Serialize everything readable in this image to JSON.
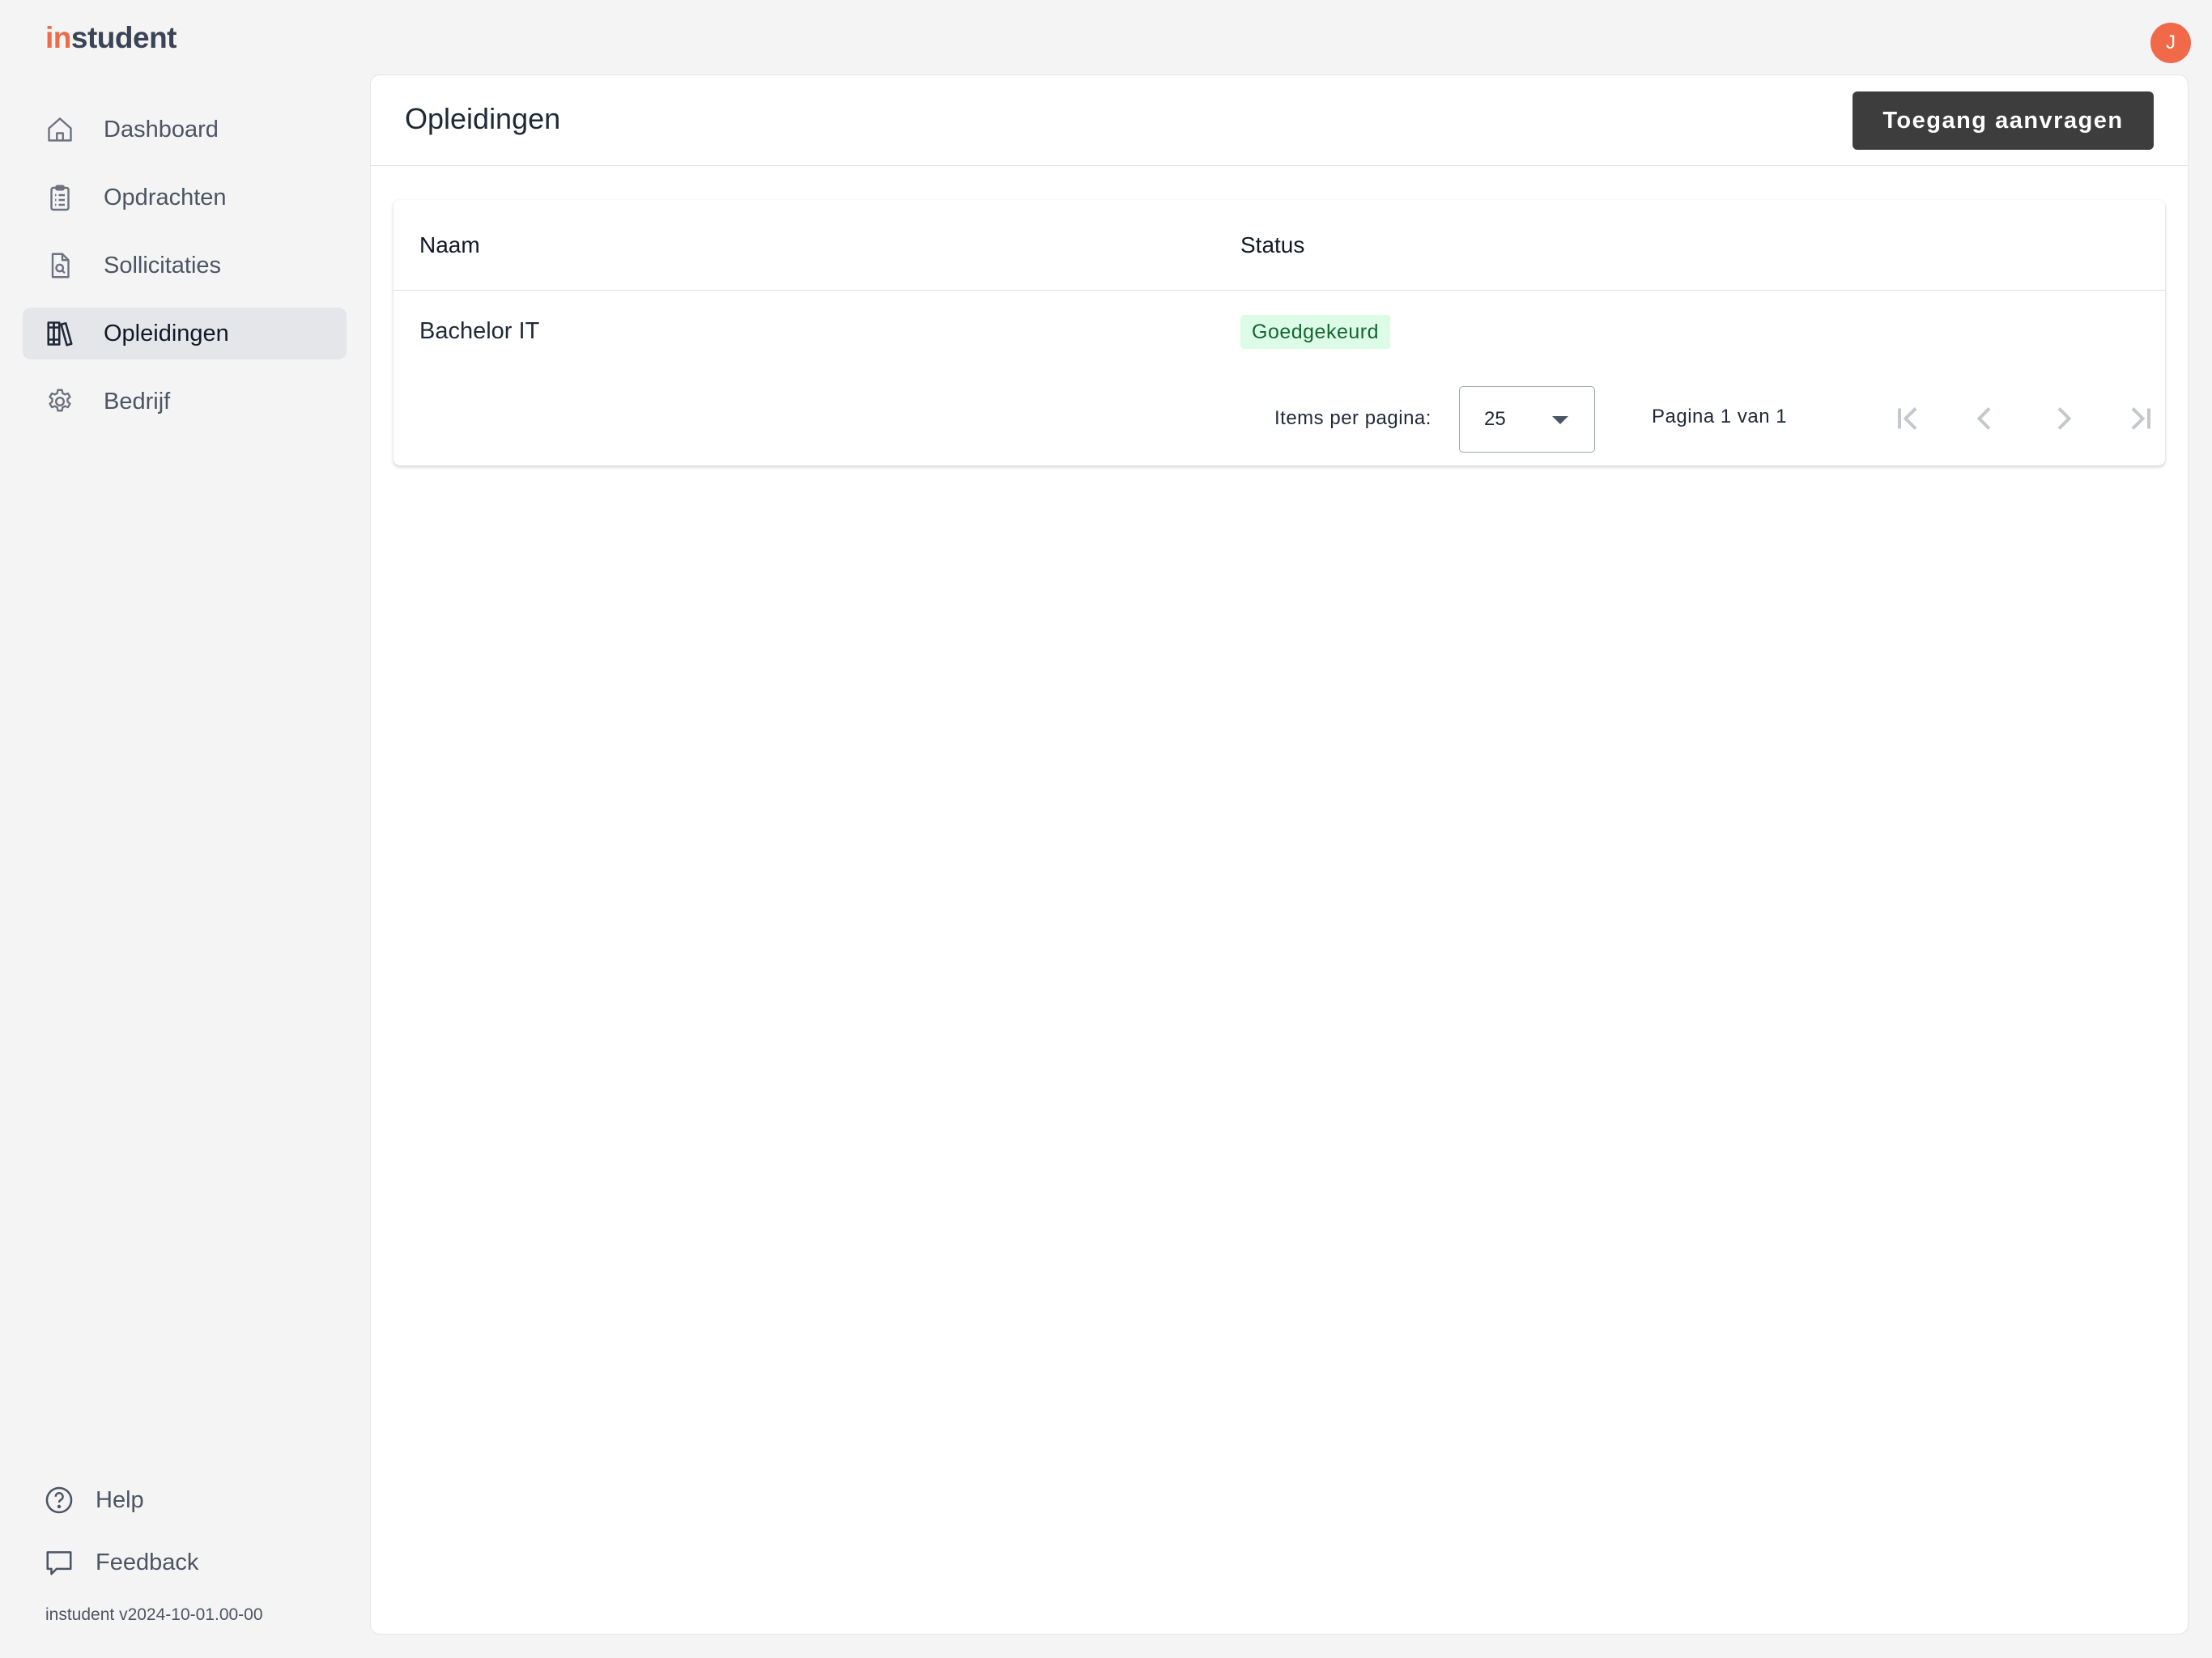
{
  "app": {
    "logo_prefix": "in",
    "logo_suffix": "student",
    "avatar_initial": "J",
    "accent_color": "#f06a4a"
  },
  "sidebar": {
    "items": [
      {
        "label": "Dashboard",
        "icon": "home-icon",
        "active": false
      },
      {
        "label": "Opdrachten",
        "icon": "clipboard-list-icon",
        "active": false
      },
      {
        "label": "Sollicitaties",
        "icon": "document-search-icon",
        "active": false
      },
      {
        "label": "Opleidingen",
        "icon": "books-icon",
        "active": true
      },
      {
        "label": "Bedrijf",
        "icon": "gear-icon",
        "active": false
      }
    ],
    "bottom": [
      {
        "label": "Help",
        "icon": "help-circle-icon"
      },
      {
        "label": "Feedback",
        "icon": "chat-bubble-icon"
      }
    ],
    "version": "instudent v2024-10-01.00-00"
  },
  "page": {
    "title": "Opleidingen",
    "primary_action": "Toegang aanvragen"
  },
  "table": {
    "columns": [
      "Naam",
      "Status"
    ],
    "rows": [
      {
        "name": "Bachelor IT",
        "status": "Goedgekeurd",
        "status_color": "#166534",
        "status_bg": "#dcfce7"
      }
    ],
    "paginator": {
      "items_per_page_label": "Items per pagina:",
      "items_per_page_value": "25",
      "range_label": "Pagina 1 van 1"
    }
  }
}
